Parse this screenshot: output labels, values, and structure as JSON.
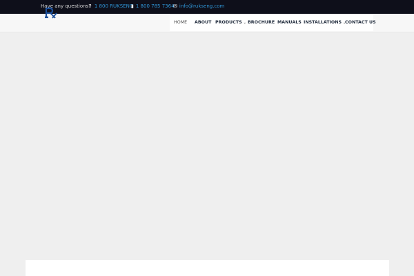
{
  "topbar": {
    "question": "Have any questions?",
    "phone1": "1 800 RUKSENG",
    "phone2": "1 800 785 7364",
    "email": "info@rukseng.com"
  },
  "logo": {
    "alt": "Rx logo"
  },
  "nav": {
    "items": [
      {
        "label": "HOME",
        "active": true,
        "dropdown": false
      },
      {
        "label": "ABOUT",
        "active": false,
        "dropdown": false
      },
      {
        "label": "PRODUCTS",
        "active": false,
        "dropdown": true
      },
      {
        "label": "BROCHURE",
        "active": false,
        "dropdown": false
      },
      {
        "label": "MANUALS",
        "active": false,
        "dropdown": false
      },
      {
        "label": "INSTALLATIONS",
        "active": false,
        "dropdown": true
      },
      {
        "label": "CONTACT US",
        "active": false,
        "dropdown": false
      }
    ]
  },
  "colors": {
    "topbar_bg": "#0e0f1a",
    "link": "#2f95d6",
    "logo": "#1a4e9a",
    "page_bg": "#efefef"
  }
}
